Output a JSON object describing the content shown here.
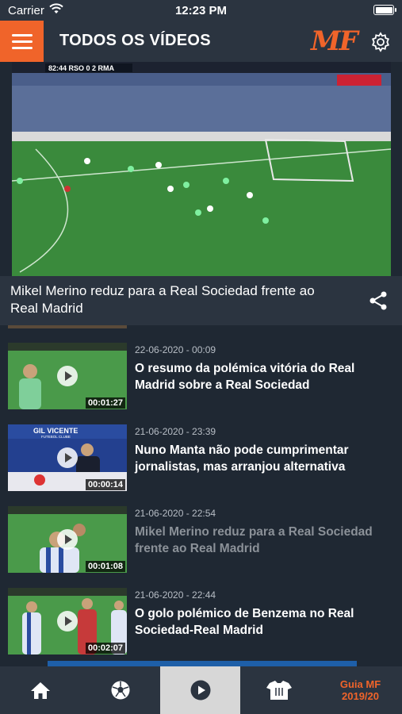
{
  "status_bar": {
    "carrier": "Carrier",
    "time": "12:23 PM"
  },
  "header": {
    "title": "TODOS OS VÍDEOS",
    "logo": "MF",
    "accent": "#f0642a"
  },
  "player": {
    "scoreboard": "82:44  RSO  0  2  RMA",
    "caption": "Mikel Merino reduz para a Real Sociedad frente ao Real Madrid"
  },
  "videos": [
    {
      "date": "22-06-2020 - 00:09",
      "title": "O resumo da polémica vitória do Real Madrid sobre a Real Sociedad",
      "duration": "00:01:27",
      "active": false
    },
    {
      "date": "21-06-2020 - 23:39",
      "title": "Nuno Manta não pode cumprimentar jornalistas, mas arranjou alternativa",
      "duration": "00:00:14",
      "active": false
    },
    {
      "date": "21-06-2020 - 22:54",
      "title": "Mikel Merino reduz para a Real Sociedad frente ao Real Madrid",
      "duration": "00:01:08",
      "active": true
    },
    {
      "date": "21-06-2020 - 22:44",
      "title": "O golo polémico de Benzema no Real Sociedad-Real Madrid",
      "duration": "00:02:07",
      "active": false
    }
  ],
  "thumb_text": {
    "club": "GIL VICENTE",
    "club_sub": "FUTEBOL CLUBE"
  },
  "tabbar": {
    "tabs": [
      "home",
      "matches",
      "videos",
      "teams"
    ],
    "guide_line1": "Guia MF",
    "guide_line2": "2019/20",
    "active_tab": "videos"
  }
}
